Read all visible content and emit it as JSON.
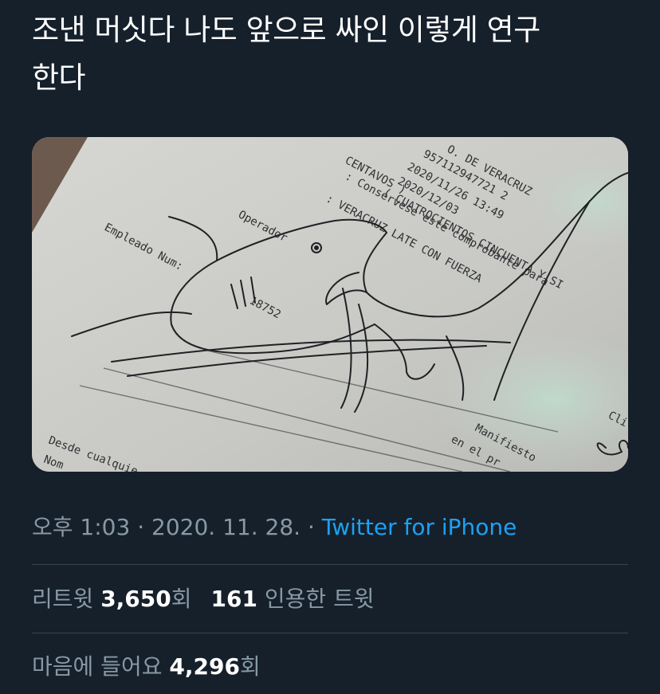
{
  "tweet": {
    "text_line1": "조낸 머싯다 나도 앞으로 싸인 이렇게 연구",
    "text_line2": "한다"
  },
  "photo_doc": {
    "line1": "O. DE VERACRUZ",
    "line2": "957112947721 2",
    "line3": "2020/11/26 13:49",
    "line4": "2020/12/03",
    "line5": "( CUATROCIENTOS CINCUENTA Y SI",
    "line6": "CENTAVOS )",
    "line7": ": Conservese este comprobante para",
    "line8": ": VERACRUZ LATE CON FUERZA",
    "operador": "Operador",
    "empleado": "Empleado Num:",
    "empleado_num": "18752",
    "manifiesto": "Manifiesto",
    "en_el": "en el pr",
    "cli": "Cli",
    "desde": "Desde cualquie",
    "nom": "Nom"
  },
  "meta": {
    "time": "오후 1:03",
    "sep1": " · ",
    "date": "2020. 11. 28.",
    "sep2": " · ",
    "source": "Twitter for iPhone"
  },
  "stats": {
    "retweet_label": "리트윗 ",
    "retweet_count": "3,650",
    "retweet_unit": "회",
    "quote_count": "161",
    "quote_label": " 인용한 트윗",
    "likes_label": "마음에 들어요 ",
    "likes_count": "4,296",
    "likes_unit": "회"
  }
}
